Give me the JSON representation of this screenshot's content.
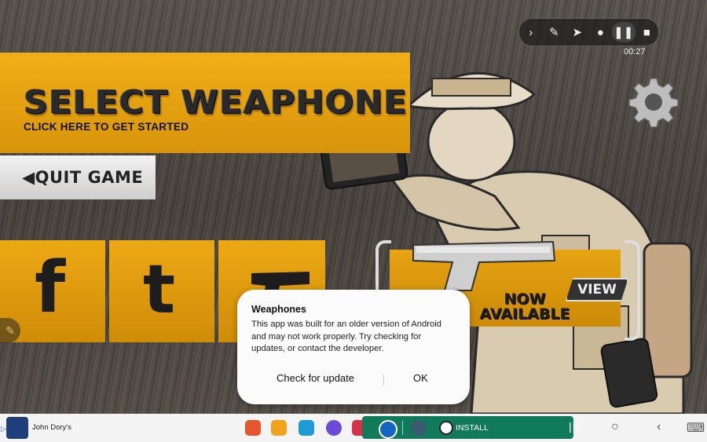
{
  "game": {
    "title": "SELECT WEAPHONE",
    "subtitle": "CLICK HERE TO GET STARTED",
    "quit_label": "QUIT GAME",
    "promo_line1": "NOW",
    "promo_line2": "AVAILABLE",
    "view_label": "VIEW",
    "social": [
      {
        "name": "facebook",
        "glyph": "f"
      },
      {
        "name": "twitter",
        "glyph": "t"
      },
      {
        "name": "gun"
      }
    ]
  },
  "recorder": {
    "timer": "00:27",
    "buttons": [
      "chevron-right-icon",
      "pen-icon",
      "pointer-icon",
      "person-icon",
      "pause-icon",
      "stop-icon"
    ]
  },
  "dialog": {
    "title": "Weaphones",
    "message": "This app was built for an older version of Android and may not work properly. Try checking for updates, or contact the developer.",
    "update_button": "Check for update",
    "ok_button": "OK"
  },
  "taskbar": {
    "ad_text": "John Dory's",
    "install_label": "INSTALL",
    "colors": {
      "install_bg": "#107a5a",
      "accent_orange": "#e8a410"
    }
  }
}
